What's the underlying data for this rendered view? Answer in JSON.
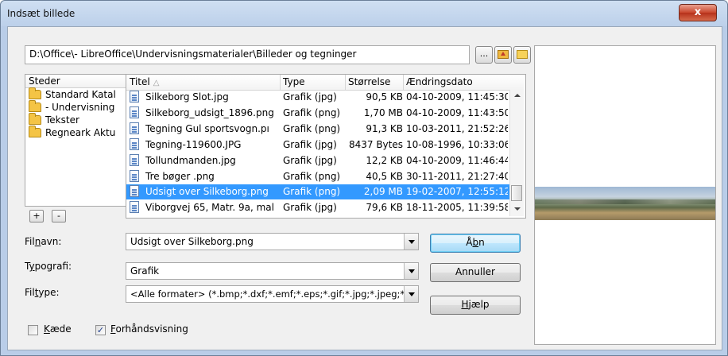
{
  "window": {
    "title": "Indsæt billede",
    "close_label": "x"
  },
  "path": {
    "value": "D:\\Office\\- LibreOffice\\Undervisningsmaterialer\\Billeder og tegninger",
    "browse_label": "..."
  },
  "places": {
    "header": "Steder",
    "items": [
      {
        "label": "Standard Katal",
        "icon": "folder-icon"
      },
      {
        "label": "- Undervisning",
        "icon": "folder-icon"
      },
      {
        "label": "Tekster",
        "icon": "folder-icon"
      },
      {
        "label": "Regneark Aktu",
        "icon": "folder-icon"
      }
    ],
    "add_label": "+",
    "remove_label": "-"
  },
  "filelist": {
    "columns": [
      "Titel",
      "Type",
      "Størrelse",
      "Ændringsdato"
    ],
    "rows": [
      {
        "name": "Silkeborg Slot.jpg",
        "type": "Grafik (jpg)",
        "size": "90,5 KB",
        "date": "04-10-2009, 11:45:30"
      },
      {
        "name": "Silkeborg_udsigt_1896.png",
        "type": "Grafik (png)",
        "size": "1,70 MB",
        "date": "04-10-2009, 11:43:50"
      },
      {
        "name": "Tegning Gul sportsvogn.pı",
        "type": "Grafik (png)",
        "size": "91,3 KB",
        "date": "10-03-2011, 21:52:26"
      },
      {
        "name": "Tegning-119600.JPG",
        "type": "Grafik (jpg)",
        "size": "8437 Bytes",
        "date": "10-08-1996, 10:33:06"
      },
      {
        "name": "Tollundmanden.jpg",
        "type": "Grafik (jpg)",
        "size": "12,2 KB",
        "date": "04-10-2009, 11:46:44"
      },
      {
        "name": "Tre bøger .png",
        "type": "Grafik (png)",
        "size": "40,5 KB",
        "date": "30-11-2011, 21:27:40"
      },
      {
        "name": "Udsigt over Silkeborg.png",
        "type": "Grafik (png)",
        "size": "2,09 MB",
        "date": "19-02-2007, 12:55:12",
        "selected": true
      },
      {
        "name": "Viborgvej 65, Matr. 9a, mal",
        "type": "Grafik (jpg)",
        "size": "79,6 KB",
        "date": "18-11-2005, 11:39:58"
      }
    ]
  },
  "form": {
    "filename_label_pre": "Fil",
    "filename_label_u": "n",
    "filename_label_post": "avn:",
    "filename_value": "Udsigt over Silkeborg.png",
    "style_label_pre": "T",
    "style_label_u": "y",
    "style_label_post": "pografi:",
    "style_value": "Grafik",
    "filetype_label_pre": "Fil",
    "filetype_label_u": "t",
    "filetype_label_post": "ype:",
    "filetype_value": "<Alle formater> (*.bmp;*.dxf;*.emf;*.eps;*.gif;*.jpg;*.jpeg;*"
  },
  "buttons": {
    "open_pre": "Å",
    "open_u": "b",
    "open_post": "n",
    "cancel": "Annuller",
    "help_pre": "",
    "help_u": "H",
    "help_post": "jælp"
  },
  "options": {
    "link_pre": "",
    "link_u": "K",
    "link_post": "æde",
    "link_checked": false,
    "preview_pre": "",
    "preview_u": "F",
    "preview_post": "orhåndsvisning",
    "preview_checked": true
  }
}
